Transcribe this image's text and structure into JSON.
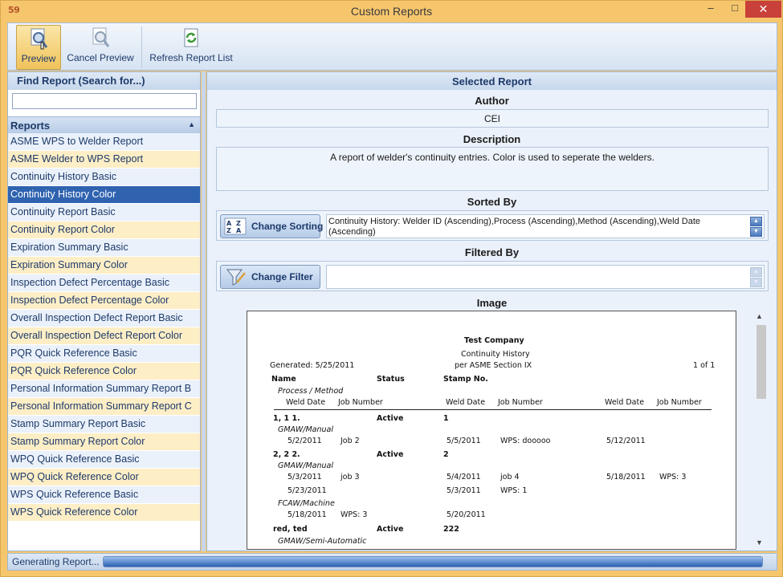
{
  "window": {
    "title": "Custom Reports",
    "app_icon": "59"
  },
  "toolbar": {
    "preview_label": "Preview",
    "cancel_label": "Cancel Preview",
    "refresh_label": "Refresh Report List"
  },
  "left": {
    "find_title": "Find Report (Search for...)",
    "search_value": "",
    "reports_title": "Reports",
    "reports": [
      "ASME WPS to Welder Report",
      "ASME Welder to WPS Report",
      "Continuity History Basic",
      "Continuity History Color",
      "Continuity Report Basic",
      "Continuity Report Color",
      "Expiration Summary Basic",
      "Expiration Summary Color",
      "Inspection Defect Percentage Basic",
      "Inspection Defect Percentage Color",
      "Overall Inspection Defect Report Basic",
      "Overall Inspection Defect Report Color",
      "PQR Quick Reference Basic",
      "PQR Quick Reference Color",
      "Personal Information Summary Report B",
      "Personal Information Summary Report C",
      "Stamp Summary Report Basic",
      "Stamp Summary Report Color",
      "WPQ Quick Reference Basic",
      "WPQ Quick Reference Color",
      "WPS Quick Reference Basic",
      "WPS Quick Reference Color"
    ],
    "selected_index": 3
  },
  "right": {
    "header": "Selected Report",
    "author_label": "Author",
    "author_value": "CEI",
    "description_label": "Description",
    "description_value": "A report of welder's continuity entries.  Color is used to seperate the welders.",
    "sorted_label": "Sorted By",
    "sort_button": "Change Sorting",
    "sort_value": "Continuity History:  Welder ID (Ascending),Process (Ascending),Method (Ascending),Weld Date (Ascending)",
    "filtered_label": "Filtered By",
    "filter_button": "Change Filter",
    "filter_value": "",
    "image_label": "Image"
  },
  "report": {
    "company": "Test Company",
    "title": "Continuity History",
    "subtitle": "per ASME Section IX",
    "generated": "Generated: 5/25/2011",
    "page": "1 of 1",
    "col_name": "Name",
    "col_status": "Status",
    "col_stamp": "Stamp No.",
    "col_process": "Process / Method",
    "col_weld_date": "Weld Date",
    "col_job": "Job Number",
    "w1_name": "1, 1 1.",
    "w1_status": "Active",
    "w1_stamp": "1",
    "w1_method": "GMAW/Manual",
    "w1_r1": [
      "5/2/2011",
      "Job 2",
      "5/5/2011",
      "WPS: dooooo",
      "5/12/2011"
    ],
    "w2_name": "2, 2 2.",
    "w2_status": "Active",
    "w2_stamp": "2",
    "w2_method1": "GMAW/Manual",
    "w2_r1": [
      "5/3/2011",
      "job 3",
      "5/4/2011",
      "job 4",
      "5/18/2011",
      "WPS: 3"
    ],
    "w2_r2": [
      "5/23/2011",
      "5/3/2011",
      "WPS: 1"
    ],
    "w2_method2": "FCAW/Machine",
    "w2_r3": [
      "5/18/2011",
      "WPS: 3",
      "5/20/2011"
    ],
    "w3_name": "red, ted",
    "w3_status": "Active",
    "w3_stamp": "222",
    "w3_method": "GMAW/Semi-Automatic"
  },
  "status": {
    "text": "Generating Report...",
    "progress": 1.0
  }
}
